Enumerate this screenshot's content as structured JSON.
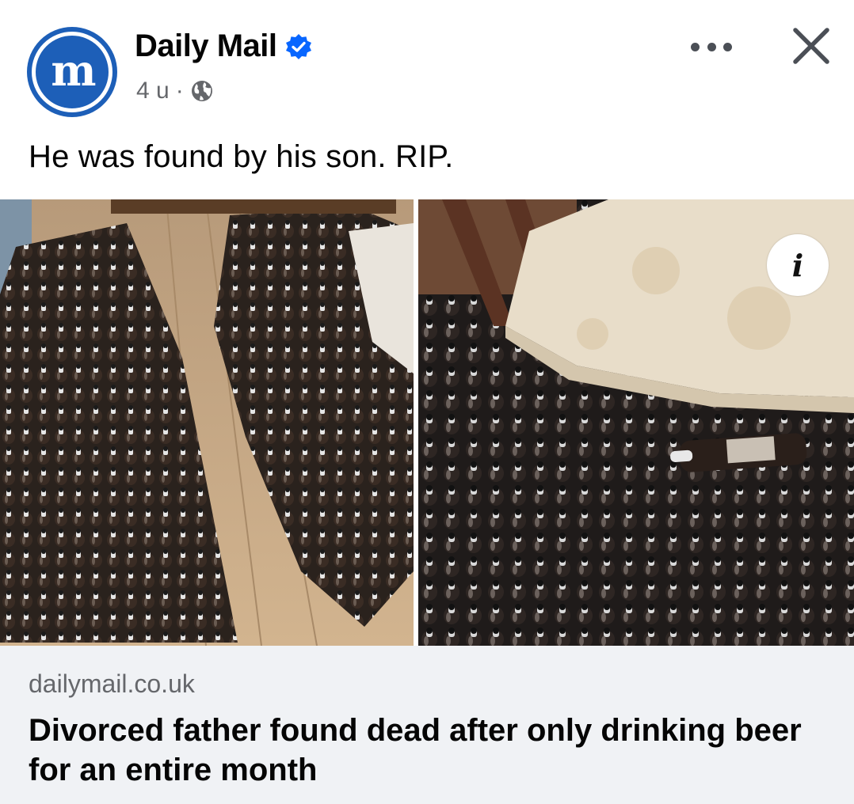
{
  "post": {
    "page_name": "Daily Mail",
    "avatar_letter": "m",
    "time": "4 u",
    "separator": "·",
    "caption": "He was found by his son. RIP."
  },
  "icons": {
    "verified": "verified-badge-icon",
    "audience": "globe-icon",
    "more": "more-options-icon",
    "close": "close-icon",
    "info": "info-icon"
  },
  "media": {
    "info_label": "i"
  },
  "link": {
    "domain": "dailymail.co.uk",
    "title": "Divorced father found dead after only drinking beer for an entire month"
  },
  "colors": {
    "brand_blue": "#1d5fb8",
    "verified_blue": "#0866ff",
    "secondary_text": "#65676b",
    "link_bg": "#f0f2f5"
  }
}
